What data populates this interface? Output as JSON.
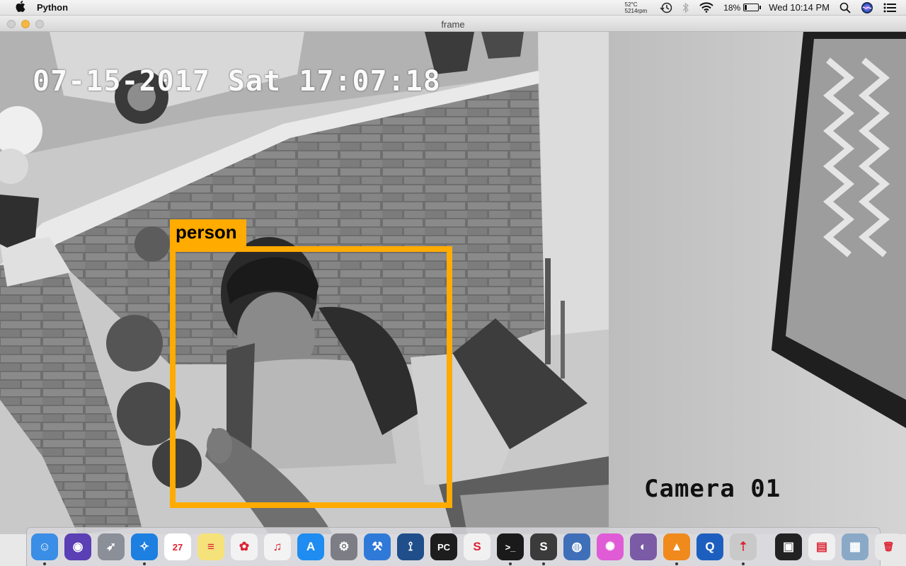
{
  "menubar": {
    "app_name": "Python",
    "temperature": "52°C",
    "fan_speed": "5214rpm",
    "battery_percent": "18%",
    "battery_level": 0.18,
    "datetime": "Wed 10:14 PM"
  },
  "window": {
    "title": "frame"
  },
  "frame": {
    "timestamp_overlay": "07-15-2017 Sat 17:07:18",
    "camera_label": "Camera 01",
    "detection": {
      "label": "person",
      "color": "#ffab00"
    }
  },
  "dock": {
    "items": [
      {
        "name": "finder",
        "icon": "finder-icon",
        "color": "#3a8ee6",
        "glyph": "☺",
        "running": true
      },
      {
        "name": "siri",
        "icon": "siri-icon",
        "color": "#5a3fb5",
        "glyph": "◉",
        "running": false
      },
      {
        "name": "launchpad",
        "icon": "rocket-icon",
        "color": "#8a8f98",
        "glyph": "➶",
        "running": false
      },
      {
        "name": "safari",
        "icon": "compass-icon",
        "color": "#1d7fe0",
        "glyph": "✧",
        "running": true
      },
      {
        "name": "calendar",
        "icon": "calendar-icon",
        "color": "#ffffff",
        "glyph": "27",
        "running": false
      },
      {
        "name": "notes",
        "icon": "notes-icon",
        "color": "#f6e27a",
        "glyph": "≡",
        "running": false
      },
      {
        "name": "photos",
        "icon": "photos-icon",
        "color": "#f2f2f2",
        "glyph": "✿",
        "running": false
      },
      {
        "name": "itunes",
        "icon": "music-icon",
        "color": "#f3f3f3",
        "glyph": "♫",
        "running": false
      },
      {
        "name": "app-store",
        "icon": "app-store-icon",
        "color": "#1e8cf0",
        "glyph": "A",
        "running": false
      },
      {
        "name": "system-preferences",
        "icon": "gear-icon",
        "color": "#7d7d85",
        "glyph": "⚙",
        "running": false
      },
      {
        "name": "xcode",
        "icon": "hammer-icon",
        "color": "#2f7ad8",
        "glyph": "⚒",
        "running": false
      },
      {
        "name": "sourcetree",
        "icon": "tree-icon",
        "color": "#1f4e8a",
        "glyph": "⟟",
        "running": false
      },
      {
        "name": "pycharm",
        "icon": "pycharm-icon",
        "color": "#1d1d1d",
        "glyph": "PC",
        "running": false
      },
      {
        "name": "sublime-merge",
        "icon": "s-icon",
        "color": "#f1f1f1",
        "glyph": "S",
        "running": false
      },
      {
        "name": "terminal",
        "icon": "terminal-icon",
        "color": "#1a1a1a",
        "glyph": ">_",
        "running": true
      },
      {
        "name": "sublime-text",
        "icon": "sublime-icon",
        "color": "#3b3b3b",
        "glyph": "S",
        "running": true
      },
      {
        "name": "network-radar",
        "icon": "globe-icon",
        "color": "#3f6fb8",
        "glyph": "◍",
        "running": false
      },
      {
        "name": "kraken",
        "icon": "octopus-icon",
        "color": "#e05bd6",
        "glyph": "✺",
        "running": false
      },
      {
        "name": "tor-browser",
        "icon": "onion-icon",
        "color": "#7b5aa6",
        "glyph": "◐",
        "running": false
      },
      {
        "name": "vlc",
        "icon": "cone-icon",
        "color": "#f08a1d",
        "glyph": "▲",
        "running": true
      },
      {
        "name": "quicktime",
        "icon": "quicktime-icon",
        "color": "#1d5fbf",
        "glyph": "Q",
        "running": false
      },
      {
        "name": "python-launcher",
        "icon": "python-rocket-icon",
        "color": "#c9c9c9",
        "glyph": "⇡",
        "running": true
      }
    ],
    "recent": [
      {
        "name": "recent-terminal-window",
        "icon": "terminal-window-icon",
        "color": "#222222",
        "glyph": "▣"
      },
      {
        "name": "recent-screenshot",
        "icon": "screenshot-icon",
        "color": "#f0f0f0",
        "glyph": "▤"
      },
      {
        "name": "recent-preview",
        "icon": "preview-icon",
        "color": "#8aa9c7",
        "glyph": "▦"
      },
      {
        "name": "trash",
        "icon": "trash-icon",
        "color": "#e8e8e8",
        "glyph": "🗑"
      }
    ]
  }
}
